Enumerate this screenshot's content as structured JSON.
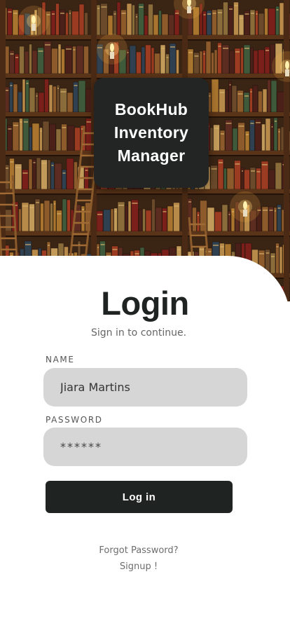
{
  "header": {
    "app_title_line1": "BookHub",
    "app_title_line2": "Inventory",
    "app_title_line3": "Manager",
    "background_image": "library-bookshelves-with-ladders-and-candles"
  },
  "login": {
    "title": "Login",
    "subtitle": "Sign in to continue.",
    "name_label": "NAME",
    "name_value": "Jiara Martins",
    "password_label": "PASSWORD",
    "password_value": "******",
    "submit_label": "Log in",
    "forgot_password": "Forgot Password?",
    "signup": "Signup !"
  },
  "colors": {
    "primary_dark": "#1f2321",
    "field_bg": "#d6d6d6",
    "panel_bg": "#ffffff"
  }
}
